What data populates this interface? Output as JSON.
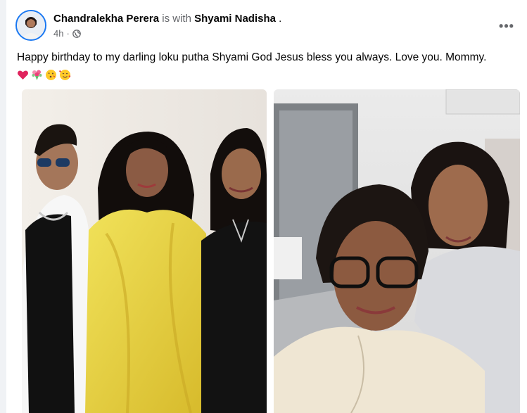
{
  "post": {
    "author": {
      "name": "Chandralekha Perera",
      "avatar": "profile-photo"
    },
    "with_text": "is with",
    "tagged": {
      "name": "Shyami Nadisha",
      "suffix": "."
    },
    "timestamp": "4h",
    "separator": "·",
    "privacy_icon": "globe-icon",
    "more_icon": "more-options-icon",
    "more_label": "•••",
    "caption": "Happy birthday to my darling loku putha Shyami God Jesus bless you always. Love you. Mommy.",
    "emojis": [
      "red-heart",
      "bouquet",
      "face-blowing-kiss",
      "smiling-face-with-hearts"
    ],
    "photos": [
      {
        "name": "photo-group-three-people",
        "description_icon": "photo"
      },
      {
        "name": "photo-selfie-two-women",
        "description_icon": "photo"
      }
    ]
  },
  "colors": {
    "accent": "#1877f2",
    "secondary_text": "#65676b",
    "primary_text": "#050505",
    "dress_yellow": "#e8d23a"
  }
}
